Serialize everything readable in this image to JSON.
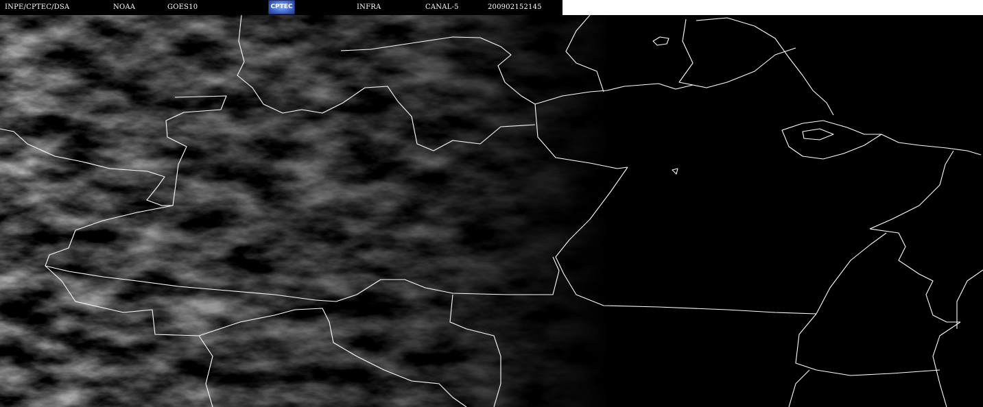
{
  "header": {
    "agency": "INPE/CPTEC/DSA",
    "provider": "NOAA",
    "satellite": "GOES10",
    "logo_text": "CPTEC",
    "band": "INFRA",
    "channel": "CANAL-5",
    "timestamp": "200902152145"
  },
  "imagery": {
    "background_color": "#000000",
    "border_color": "#ffffff",
    "cloud_tint": "#7a7a7a"
  }
}
